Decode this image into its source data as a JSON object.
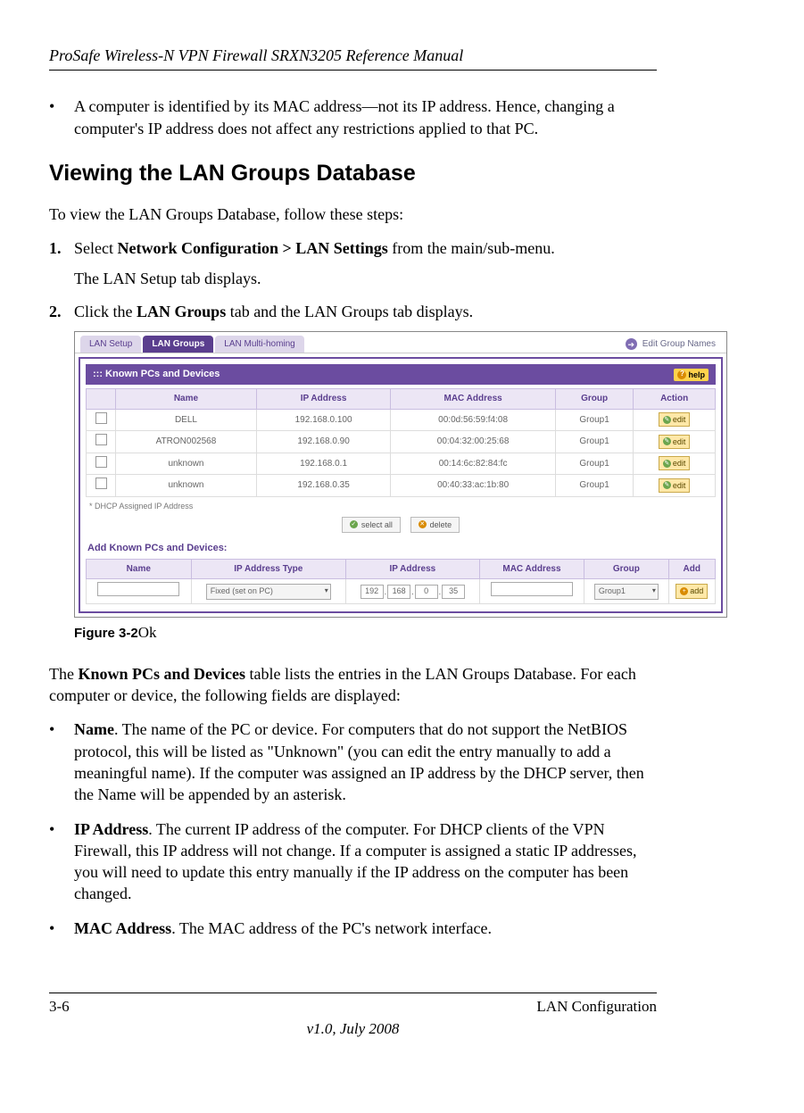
{
  "header": {
    "doc_title": "ProSafe Wireless-N VPN Firewall SRXN3205 Reference Manual"
  },
  "top_bullet": "A computer is identified by its MAC address—not its IP address. Hence, changing a computer's IP address does not affect any restrictions applied to that PC.",
  "section_heading": "Viewing the LAN Groups Database",
  "intro_para": "To view the LAN Groups Database, follow these steps:",
  "steps": {
    "s1_num": "1.",
    "s1_pre": "Select ",
    "s1_bold": "Network Configuration > LAN Settings",
    "s1_post": " from the main/sub-menu.",
    "s1_sub": "The LAN Setup tab displays.",
    "s2_num": "2.",
    "s2_pre": "Click the ",
    "s2_bold": "LAN Groups",
    "s2_post": " tab and the LAN Groups tab displays."
  },
  "fig": {
    "tabs": {
      "t1": "LAN Setup",
      "t2": "LAN Groups",
      "t3": "LAN Multi-homing"
    },
    "edit_group_names": "Edit Group Names",
    "panel_title": "Known PCs and Devices",
    "help": "help",
    "cols": {
      "name": "Name",
      "ip": "IP Address",
      "mac": "MAC Address",
      "group": "Group",
      "action": "Action"
    },
    "rows": [
      {
        "name": "DELL",
        "ip": "192.168.0.100",
        "mac": "00:0d:56:59:f4:08",
        "group": "Group1"
      },
      {
        "name": "ATRON002568",
        "ip": "192.168.0.90",
        "mac": "00:04:32:00:25:68",
        "group": "Group1"
      },
      {
        "name": "unknown",
        "ip": "192.168.0.1",
        "mac": "00:14:6c:82:84:fc",
        "group": "Group1"
      },
      {
        "name": "unknown",
        "ip": "192.168.0.35",
        "mac": "00:40:33:ac:1b:80",
        "group": "Group1"
      }
    ],
    "edit_label": "edit",
    "footnote": "* DHCP Assigned IP Address",
    "btn_select_all": "select all",
    "btn_delete": "delete",
    "add_heading": "Add Known PCs and Devices:",
    "add_cols": {
      "name": "Name",
      "iptype": "IP Address Type",
      "ip": "IP Address",
      "mac": "MAC Address",
      "group": "Group",
      "add": "Add"
    },
    "add_row": {
      "iptype_val": "Fixed (set on PC)",
      "oct1": "192",
      "oct2": "168",
      "oct3": "0",
      "oct4": "35",
      "group_val": "Group1",
      "add_label": "add"
    }
  },
  "fig_caption": {
    "label": "Figure 3-2",
    "suffix": "Ok"
  },
  "after_fig_para_pre": "The ",
  "after_fig_para_bold": "Known PCs and Devices",
  "after_fig_para_post": " table lists the entries in the LAN Groups Database. For each computer or device, the following fields are displayed:",
  "fields": {
    "name_label": "Name",
    "name_text": ". The name of the PC or device. For computers that do not support the NetBIOS protocol, this will be listed as \"Unknown\" (you can edit the entry manually to add a meaningful name). If the computer was assigned an IP address by the DHCP server, then the Name will be appended by an asterisk.",
    "ip_label": "IP Address",
    "ip_text": ". The current IP address of the computer. For DHCP clients of the VPN Firewall, this IP address will not change. If a computer is assigned a static IP addresses, you will need to update this entry manually if the IP address on the computer has been changed.",
    "mac_label": "MAC Address",
    "mac_text": ". The MAC address of the PC's network interface."
  },
  "footer": {
    "page": "3-6",
    "section": "LAN Configuration",
    "version": "v1.0, July 2008"
  }
}
